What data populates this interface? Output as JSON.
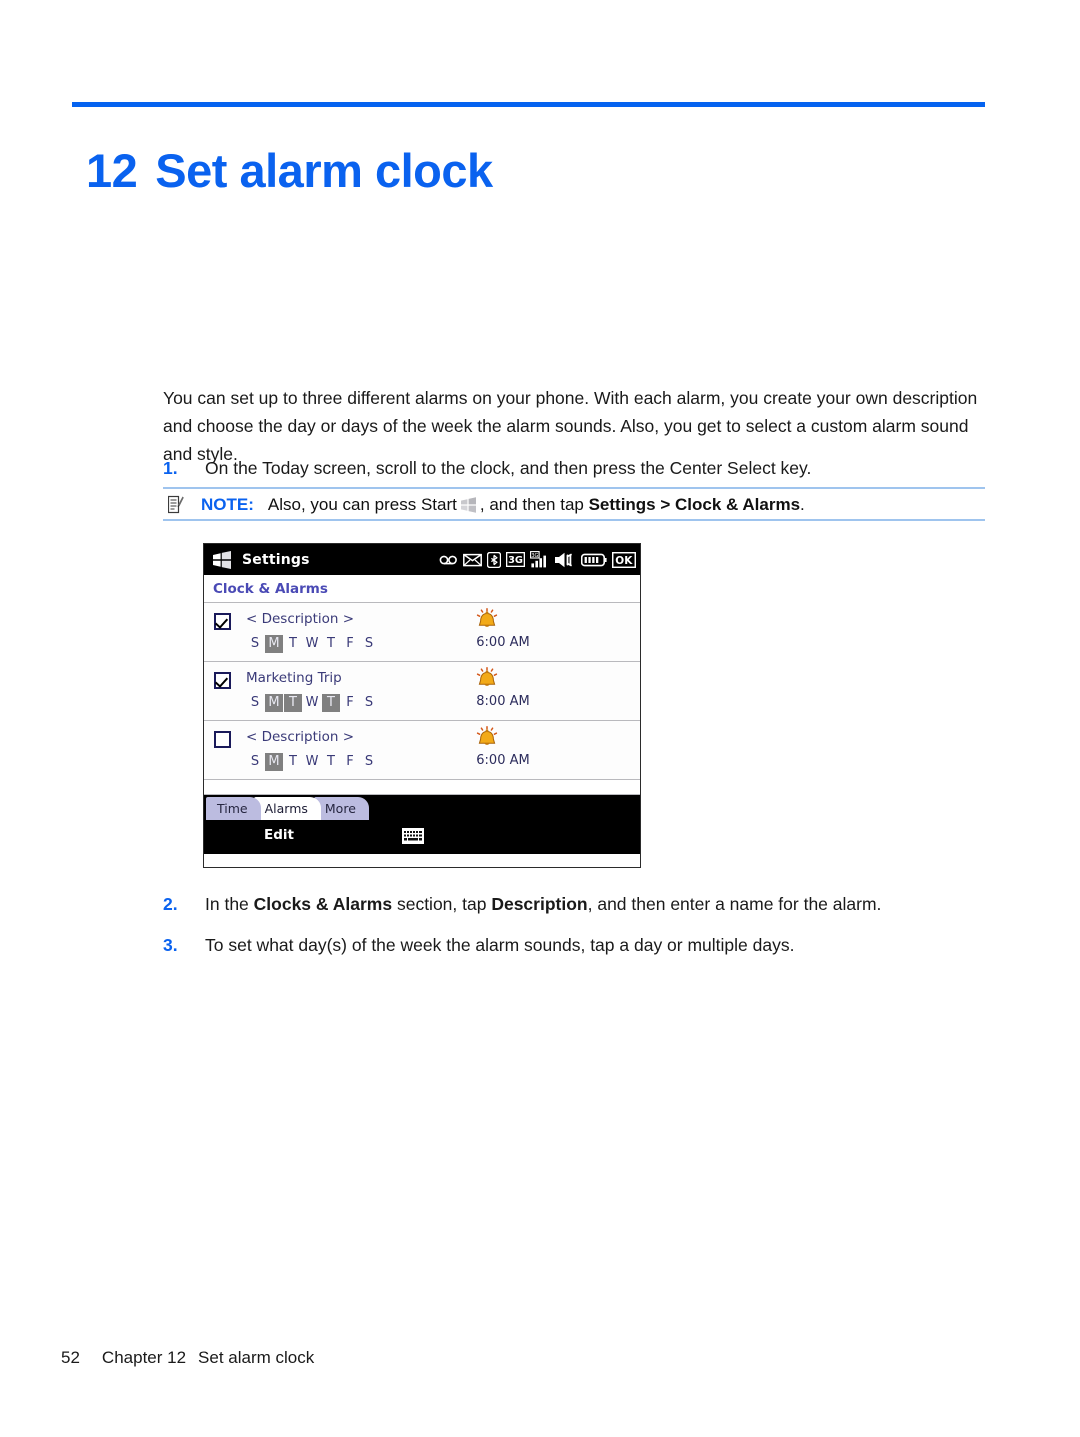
{
  "chapter": {
    "number": "12",
    "title": "Set alarm clock"
  },
  "intro_paragraph": "You can set up to three different alarms on your phone. With each alarm, you create your own description and choose the day or days of the week the alarm sounds. Also, you get to select a custom alarm sound and style.",
  "steps": [
    {
      "number": "1.",
      "text": "On the Today screen, scroll to the clock, and then press the Center Select key."
    },
    {
      "number": "2.",
      "text_before": "In the ",
      "bold_1": "Clocks & Alarms",
      "text_mid": " section, tap ",
      "bold_2": "Description",
      "text_after": ", and then enter a name for the alarm."
    },
    {
      "number": "3.",
      "text": "To set what day(s) of the week the alarm sounds, tap a day or multiple days."
    }
  ],
  "note": {
    "icon": "note-pencil-icon",
    "label": "NOTE:",
    "text_before": "Also, you can press Start",
    "start_icon": "windows-start-icon",
    "text_mid": ", and then tap ",
    "bold_path": "Settings > Clock & Alarms",
    "text_after": "."
  },
  "device": {
    "titlebar": {
      "start_icon": "windows-start-icon",
      "title": "Settings",
      "status_icons": [
        "voicemail-icon",
        "envelope-icon",
        "bluetooth-icon",
        "3g-icon",
        "signal-bars-icon",
        "speaker-icon",
        "battery-icon",
        "ok-button"
      ]
    },
    "page_header": "Clock & Alarms",
    "day_letters": [
      "S",
      "M",
      "T",
      "W",
      "T",
      "F",
      "S"
    ],
    "alarms": [
      {
        "checked": true,
        "description": "< Description >",
        "days_selected": [
          false,
          true,
          false,
          false,
          false,
          false,
          false
        ],
        "bell_icon": "alarm-bell-icon",
        "time": "6:00 AM"
      },
      {
        "checked": true,
        "description": "Marketing Trip",
        "days_selected": [
          false,
          true,
          true,
          false,
          true,
          false,
          false
        ],
        "bell_icon": "alarm-bell-icon",
        "time": "8:00 AM"
      },
      {
        "checked": false,
        "description": "< Description >",
        "days_selected": [
          false,
          true,
          false,
          false,
          false,
          false,
          false
        ],
        "bell_icon": "alarm-bell-icon",
        "time": "6:00 AM"
      }
    ],
    "tabs": [
      {
        "label": "Time",
        "active": false
      },
      {
        "label": "Alarms",
        "active": true
      },
      {
        "label": "More",
        "active": false
      }
    ],
    "command_bar": {
      "edit_label": "Edit",
      "keyboard_icon": "keyboard-icon"
    }
  },
  "footer": {
    "page_number": "52",
    "chapter_label": "Chapter 12",
    "chapter_title": "Set alarm clock"
  },
  "colors": {
    "accent_blue": "#0a62ef",
    "note_rule": "#9fc4ee",
    "tab_inactive": "#bcbce0",
    "header_purple": "#4a4ab5",
    "day_selected": "#808080"
  }
}
